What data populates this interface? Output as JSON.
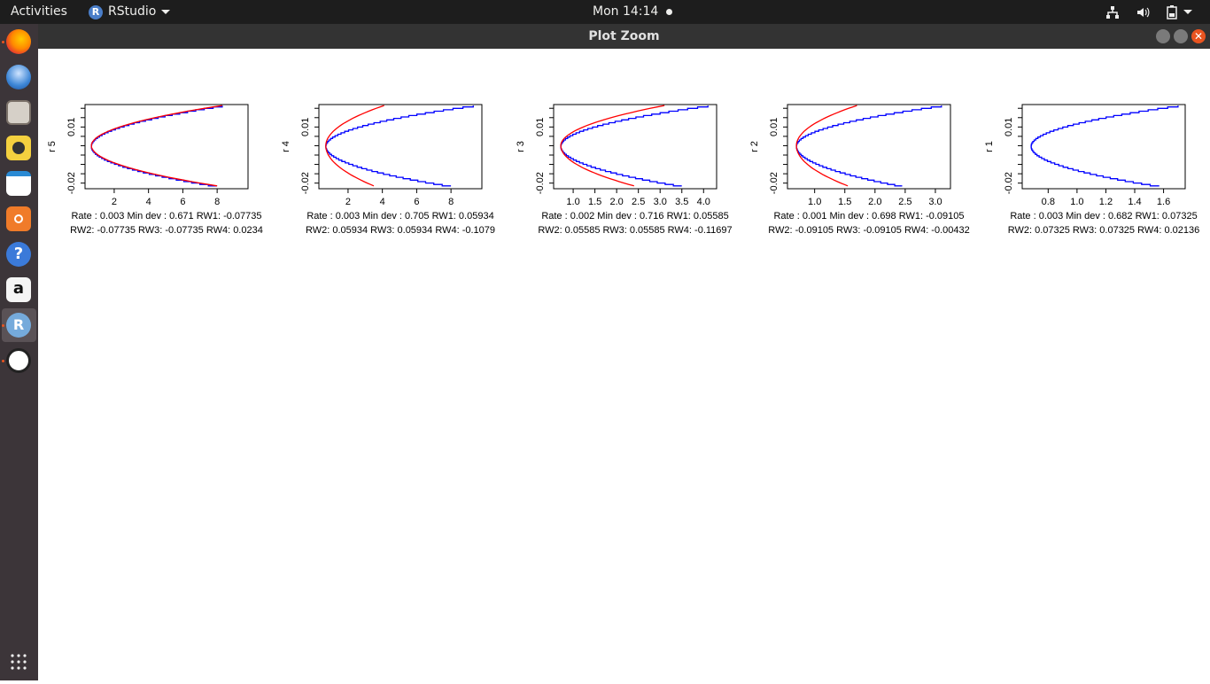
{
  "topbar": {
    "activities": "Activities",
    "app_name": "RStudio",
    "app_badge": "R",
    "clock": "Mon 14:14"
  },
  "window": {
    "title": "Plot Zoom"
  },
  "dock": {
    "items": [
      "firefox-icon",
      "thunderbird-icon",
      "files-icon",
      "rhythmbox-icon",
      "libreoffice-writer-icon",
      "ubuntu-software-icon",
      "help-icon",
      "amazon-icon",
      "rstudio-icon",
      "software-updater-icon",
      "show-applications-icon"
    ]
  },
  "colors": {
    "series_fit": "#ff0000",
    "series_profile": "#0000ff"
  },
  "chart_data": [
    {
      "type": "line",
      "ylabel": "r 5",
      "xlim": [
        0.3,
        9.8
      ],
      "ylim": [
        -0.023,
        0.022
      ],
      "xticks": [
        2,
        4,
        6,
        8
      ],
      "yticks": [
        -0.02,
        0.01
      ],
      "series": [
        {
          "color": "#0000ff",
          "step": true,
          "x": [
            8.3,
            0.67,
            8.0
          ],
          "y": [
            0.0215,
            0.0,
            -0.0215
          ]
        },
        {
          "color": "#ff0000",
          "x": [
            8.3,
            0.67,
            8.0
          ],
          "y": [
            0.0215,
            0.0,
            -0.0215
          ]
        }
      ],
      "caption1": "Rate : 0.003 Min dev : 0.671 RW1:  -0.07735",
      "caption2": "RW2:  -0.07735 RW3:  -0.07735 RW4:  0.0234"
    },
    {
      "type": "line",
      "ylabel": "r 4",
      "xlim": [
        0.3,
        9.8
      ],
      "ylim": [
        -0.023,
        0.022
      ],
      "xticks": [
        2,
        4,
        6,
        8
      ],
      "yticks": [
        -0.02,
        0.01
      ],
      "series": [
        {
          "color": "#0000ff",
          "step": true,
          "x": [
            9.3,
            0.705,
            8.0
          ],
          "y": [
            0.0215,
            0.0,
            -0.0215
          ]
        },
        {
          "color": "#ff0000",
          "x": [
            4.1,
            0.705,
            3.5
          ],
          "y": [
            0.0215,
            0.0,
            -0.0215
          ]
        }
      ],
      "caption1": "Rate : 0.003 Min dev : 0.705 RW1:  0.05934",
      "caption2": "RW2:  0.05934 RW3:  0.05934 RW4:  -0.1079"
    },
    {
      "type": "line",
      "ylabel": "r 3",
      "xlim": [
        0.55,
        4.3
      ],
      "ylim": [
        -0.023,
        0.022
      ],
      "xticks": [
        1.0,
        1.5,
        2.0,
        2.5,
        3.0,
        3.5,
        4.0
      ],
      "yticks": [
        -0.02,
        0.01
      ],
      "series": [
        {
          "color": "#0000ff",
          "step": true,
          "x": [
            4.1,
            0.716,
            3.5
          ],
          "y": [
            0.0215,
            0.0,
            -0.0215
          ]
        },
        {
          "color": "#ff0000",
          "x": [
            3.1,
            0.716,
            2.4
          ],
          "y": [
            0.0215,
            0.0,
            -0.0215
          ]
        }
      ],
      "caption1": "Rate : 0.002 Min dev : 0.716 RW1:  0.05585",
      "caption2": "RW2:  0.05585 RW3:  0.05585 RW4:  -0.11697"
    },
    {
      "type": "line",
      "ylabel": "r 2",
      "xlim": [
        0.55,
        3.25
      ],
      "ylim": [
        -0.023,
        0.022
      ],
      "xticks": [
        1.0,
        1.5,
        2.0,
        2.5,
        3.0
      ],
      "yticks": [
        -0.02,
        0.01
      ],
      "series": [
        {
          "color": "#0000ff",
          "step": true,
          "x": [
            3.1,
            0.698,
            2.45
          ],
          "y": [
            0.0215,
            0.0,
            -0.0215
          ]
        },
        {
          "color": "#ff0000",
          "x": [
            1.7,
            0.698,
            1.55
          ],
          "y": [
            0.0215,
            0.0,
            -0.0215
          ]
        }
      ],
      "caption1": "Rate : 0.001 Min dev : 0.698 RW1:  -0.09105",
      "caption2": "RW2:  -0.09105 RW3:  -0.09105 RW4:  -0.00432"
    },
    {
      "type": "line",
      "ylabel": "r 1",
      "xlim": [
        0.62,
        1.75
      ],
      "ylim": [
        -0.023,
        0.022
      ],
      "xticks": [
        0.8,
        1.0,
        1.2,
        1.4,
        1.6
      ],
      "yticks": [
        -0.02,
        0.01
      ],
      "series": [
        {
          "color": "#0000ff",
          "step": true,
          "x": [
            1.7,
            0.682,
            1.57
          ],
          "y": [
            0.0215,
            0.0,
            -0.0215
          ]
        }
      ],
      "caption1": "Rate : 0.003 Min dev : 0.682 RW1:  0.07325",
      "caption2": "RW2:  0.07325 RW3:  0.07325 RW4:  0.02136"
    }
  ]
}
